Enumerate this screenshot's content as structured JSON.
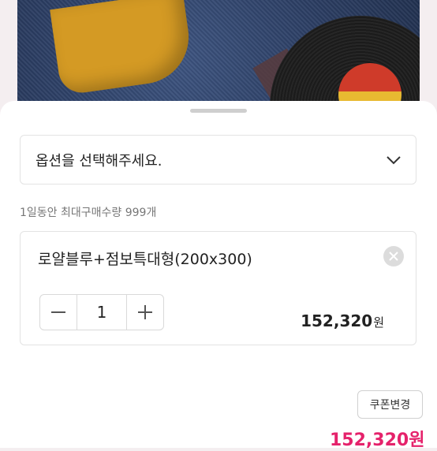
{
  "option_select": {
    "placeholder": "옵션을 선택해주세요.",
    "icon": "chevron-down-icon"
  },
  "purchase_limit": "1일동안 최대구매수량 999개",
  "selected_option": {
    "name": "로얄블루+점보특대형(200x300)",
    "quantity": "1",
    "price": "152,320",
    "price_unit": "원"
  },
  "coupon_button": "쿠폰변경",
  "total": {
    "price": "152,320",
    "unit": "원"
  },
  "colors": {
    "accent": "#e5226b",
    "text": "#222222",
    "border": "#e3e3e3"
  }
}
